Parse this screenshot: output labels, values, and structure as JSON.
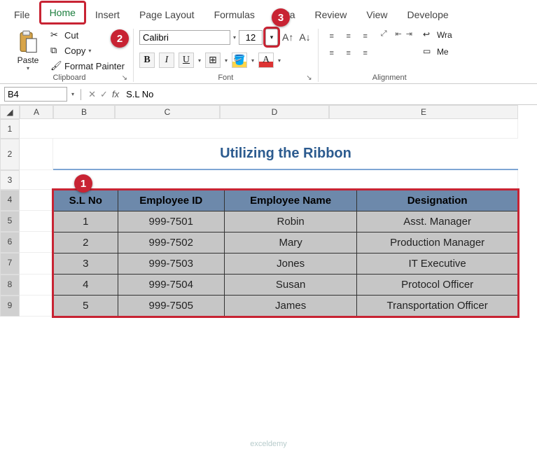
{
  "tabs": {
    "file": "File",
    "home": "Home",
    "insert": "Insert",
    "page_layout": "Page Layout",
    "formulas": "Formulas",
    "data": "Data",
    "review": "Review",
    "view": "View",
    "developer": "Develope"
  },
  "clipboard": {
    "paste": "Paste",
    "cut": "Cut",
    "copy": "Copy",
    "fmt_painter": "Format Painter",
    "label": "Clipboard"
  },
  "font": {
    "name": "Calibri",
    "size": "12",
    "bold": "B",
    "italic": "I",
    "underline": "U",
    "label": "Font"
  },
  "align": {
    "wrap": "Wra",
    "merge": "Me",
    "label": "Alignment"
  },
  "namebox": "B4",
  "formula": "S.L No",
  "title_text": "Utilizing the Ribbon",
  "headers": [
    "S.L No",
    "Employee ID",
    "Employee Name",
    "Designation"
  ],
  "rows": [
    [
      "1",
      "999-7501",
      "Robin",
      "Asst. Manager"
    ],
    [
      "2",
      "999-7502",
      "Mary",
      "Production Manager"
    ],
    [
      "3",
      "999-7503",
      "Jones",
      "IT Executive"
    ],
    [
      "4",
      "999-7504",
      "Susan",
      "Protocol Officer"
    ],
    [
      "5",
      "999-7505",
      "James",
      "Transportation Officer"
    ]
  ],
  "col_letters": [
    "A",
    "B",
    "C",
    "D",
    "E"
  ],
  "row_nums": [
    "1",
    "2",
    "3",
    "4",
    "5",
    "6",
    "7",
    "8",
    "9"
  ],
  "callouts": {
    "c1": "1",
    "c2": "2",
    "c3": "3"
  },
  "watermark": "exceldemy"
}
